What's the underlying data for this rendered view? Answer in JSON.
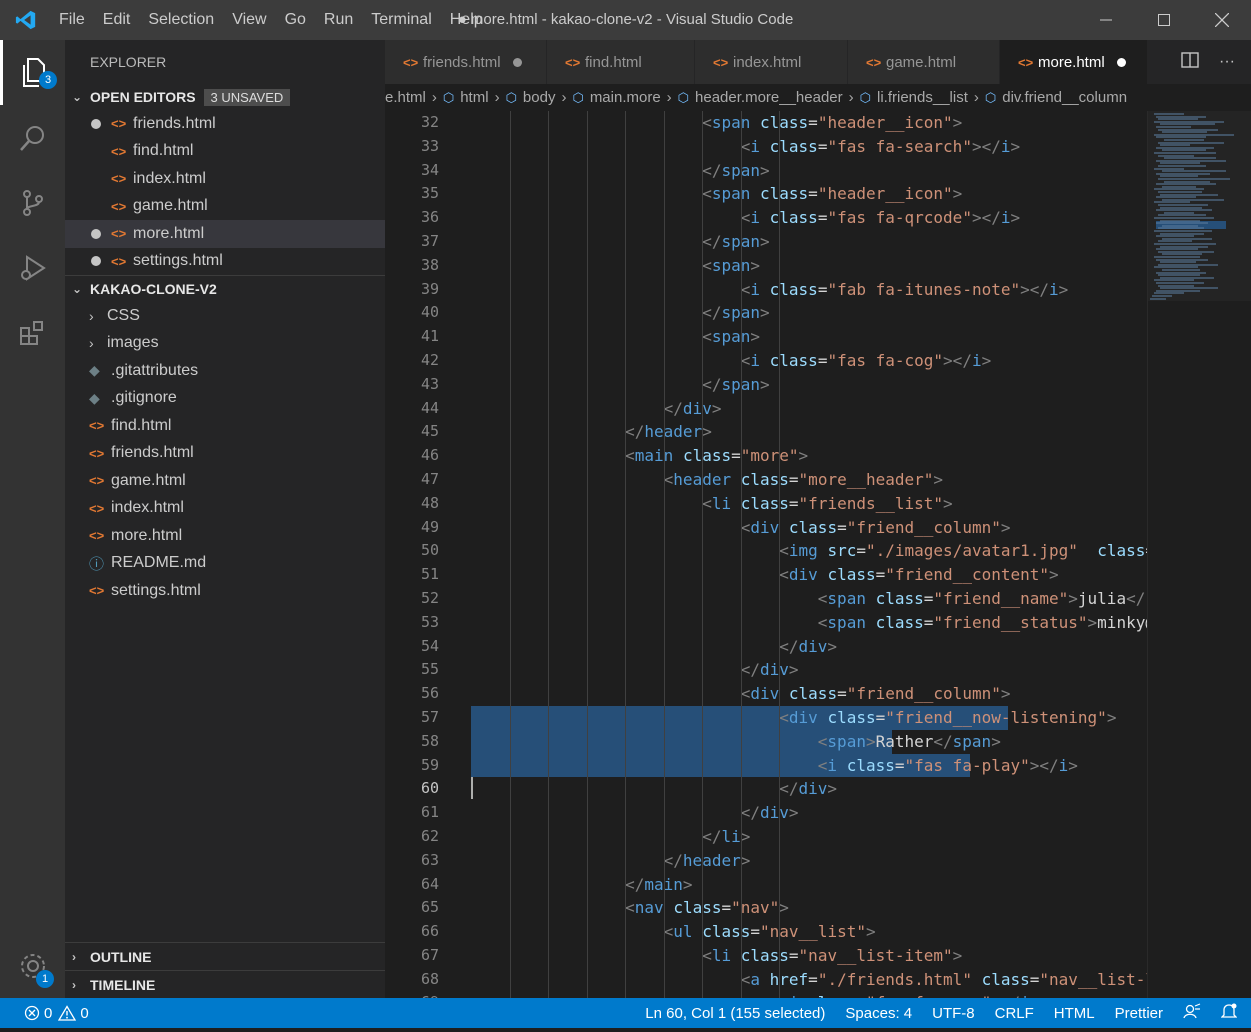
{
  "titlebar": {
    "menus": [
      "File",
      "Edit",
      "Selection",
      "View",
      "Go",
      "Run",
      "Terminal",
      "Help"
    ],
    "title": "● more.html - kakao-clone-v2 - Visual Studio Code"
  },
  "activity": {
    "explorer_badge": "3",
    "settings_badge": "1"
  },
  "sidebar": {
    "title": "EXPLORER",
    "open_editors": {
      "label": "OPEN EDITORS",
      "unsaved": "3 UNSAVED",
      "items": [
        {
          "name": "friends.html",
          "modified": true
        },
        {
          "name": "find.html",
          "modified": false
        },
        {
          "name": "index.html",
          "modified": false
        },
        {
          "name": "game.html",
          "modified": false
        },
        {
          "name": "more.html",
          "modified": true
        },
        {
          "name": "settings.html",
          "modified": true
        }
      ]
    },
    "project": {
      "label": "KAKAO-CLONE-V2",
      "folders": [
        "CSS",
        "images"
      ],
      "files": [
        ".gitattributes",
        ".gitignore",
        "find.html",
        "friends.html",
        "game.html",
        "index.html",
        "more.html",
        "README.md",
        "settings.html"
      ]
    },
    "outline": "OUTLINE",
    "timeline": "TIMELINE"
  },
  "tabs": [
    {
      "name": "friends.html",
      "modified": true
    },
    {
      "name": "find.html",
      "modified": false
    },
    {
      "name": "index.html",
      "modified": false
    },
    {
      "name": "game.html",
      "modified": false
    },
    {
      "name": "more.html",
      "modified": true
    }
  ],
  "breadcrumb": [
    "e.html",
    "html",
    "body",
    "main.more",
    "header.more__header",
    "li.friends__list",
    "div.friend__column"
  ],
  "editor": {
    "line_numbers": [
      "32",
      "33",
      "34",
      "35",
      "36",
      "37",
      "38",
      "39",
      "40",
      "41",
      "42",
      "43",
      "44",
      "45",
      "46",
      "47",
      "48",
      "49",
      "50",
      "51",
      "52",
      "53",
      "54",
      "55",
      "56",
      "57",
      "58",
      "59",
      "60",
      "61",
      "62",
      "63",
      "64",
      "65",
      "66",
      "67",
      "68",
      "69"
    ]
  },
  "status": {
    "errors": "0",
    "warnings": "0",
    "position": "Ln 60, Col 1 (155 selected)",
    "spaces": "Spaces: 4",
    "encoding": "UTF-8",
    "eol": "CRLF",
    "language": "HTML",
    "formatter": "Prettier"
  }
}
